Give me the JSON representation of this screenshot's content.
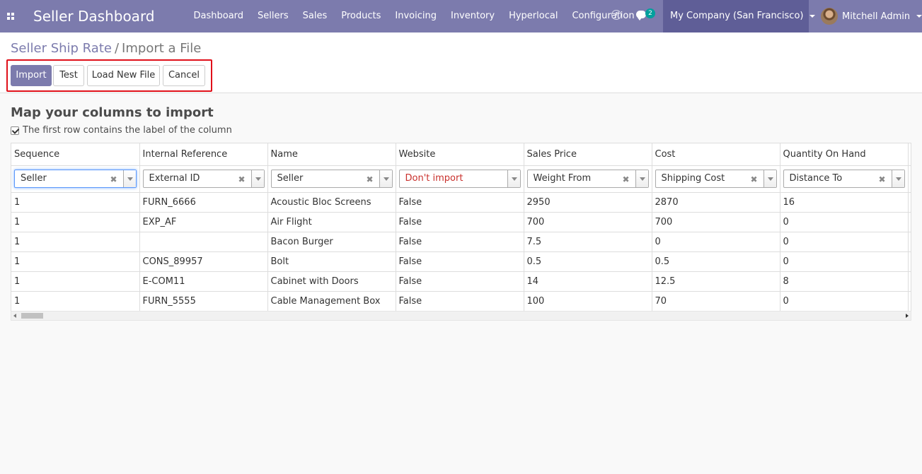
{
  "navbar": {
    "brand": "Seller Dashboard",
    "menu": [
      "Dashboard",
      "Sellers",
      "Sales",
      "Products",
      "Invoicing",
      "Inventory",
      "Hyperlocal",
      "Configuration"
    ],
    "chat_badge": "2",
    "company": "My Company (San Francisco)",
    "user": "Mitchell Admin"
  },
  "breadcrumb": {
    "parent": "Seller Ship Rate",
    "separator": "/",
    "current": "Import a File"
  },
  "buttons": {
    "import": "Import",
    "test": "Test",
    "load": "Load New File",
    "cancel": "Cancel"
  },
  "mapping": {
    "heading": "Map your columns to import",
    "first_row_label": "The first row contains the label of the column",
    "columns": [
      "Sequence",
      "Internal Reference",
      "Name",
      "Website",
      "Sales Price",
      "Cost",
      "Quantity On Hand"
    ],
    "selects": [
      "Seller",
      "External ID",
      "Seller",
      "Don't import",
      "Weight From",
      "Shipping Cost",
      "Distance To"
    ],
    "rows": [
      [
        "1",
        "FURN_6666",
        "Acoustic Bloc Screens",
        "False",
        "2950",
        "2870",
        "16"
      ],
      [
        "1",
        "EXP_AF",
        "Air Flight",
        "False",
        "700",
        "700",
        "0"
      ],
      [
        "1",
        "",
        "Bacon Burger",
        "False",
        "7.5",
        "0",
        "0"
      ],
      [
        "1",
        "CONS_89957",
        "Bolt",
        "False",
        "0.5",
        "0.5",
        "0"
      ],
      [
        "1",
        "E-COM11",
        "Cabinet with Doors",
        "False",
        "14",
        "12.5",
        "8"
      ],
      [
        "1",
        "FURN_5555",
        "Cable Management Box",
        "False",
        "100",
        "70",
        "0"
      ]
    ]
  },
  "colors": {
    "navbar": "#7c7bad",
    "navbar_active": "#5f5e97",
    "primary_button": "#7c7bad",
    "highlight_border": "#e0101a",
    "warning_text": "#c9302c",
    "badge": "#00a09d"
  }
}
